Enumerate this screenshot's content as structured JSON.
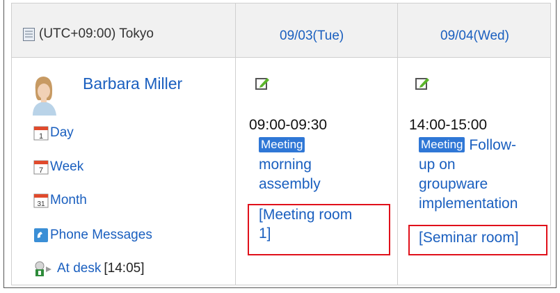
{
  "header": {
    "timezone": "(UTC+09:00) Tokyo",
    "dates": [
      "09/03(Tue)",
      "09/04(Wed)"
    ]
  },
  "user": {
    "name": "Barbara Miller",
    "nav": {
      "day": {
        "label": "Day",
        "icon_number": "1"
      },
      "week": {
        "label": "Week",
        "icon_number": "7"
      },
      "month": {
        "label": "Month",
        "icon_number": "31"
      },
      "phone": {
        "label": "Phone Messages"
      },
      "presence": {
        "label": "At desk",
        "time": "[14:05]"
      }
    }
  },
  "events": [
    {
      "date": "09/03(Tue)",
      "time": "09:00-09:30",
      "badge": "Meeting",
      "title_lines": [
        "morning",
        "assembly"
      ],
      "facility_lines": [
        "[Meeting room",
        "1]"
      ]
    },
    {
      "date": "09/04(Wed)",
      "time": "14:00-15:00",
      "badge": "Meeting",
      "title_lines": [
        "Follow-",
        "up on",
        "groupware",
        "implementation"
      ],
      "facility_lines": [
        "[Seminar room]"
      ]
    }
  ],
  "colors": {
    "link": "#1a5fbf",
    "badge": "#2f77d6",
    "highlight_box": "#e0101a",
    "header_bg": "#f1f1f1"
  }
}
